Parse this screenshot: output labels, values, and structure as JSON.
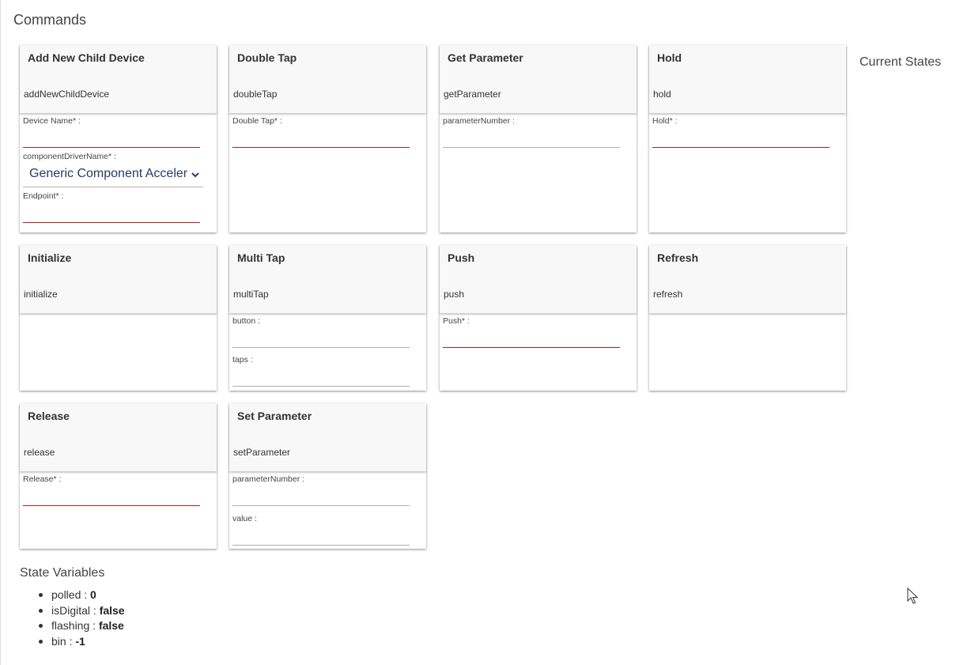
{
  "header": {
    "title": "Commands",
    "current_states": "Current States"
  },
  "commands": {
    "add_new_child_device": {
      "name": "Add New Child Device",
      "method": "addNewChildDevice",
      "fields": {
        "device_name": {
          "label": "Device Name* :",
          "value": ""
        },
        "component_driver_name": {
          "label": "componentDriverName* :",
          "selected": "Generic Component Accelerometer"
        },
        "endpoint": {
          "label": "Endpoint* :",
          "value": ""
        }
      }
    },
    "double_tap": {
      "name": "Double Tap",
      "method": "doubleTap",
      "fields": {
        "double_tap": {
          "label": "Double Tap* :",
          "value": ""
        }
      }
    },
    "get_parameter": {
      "name": "Get Parameter",
      "method": "getParameter",
      "fields": {
        "parameter_number": {
          "label": "parameterNumber :",
          "value": ""
        }
      }
    },
    "hold": {
      "name": "Hold",
      "method": "hold",
      "fields": {
        "hold": {
          "label": "Hold* :",
          "value": ""
        }
      }
    },
    "initialize": {
      "name": "Initialize",
      "method": "initialize"
    },
    "multi_tap": {
      "name": "Multi Tap",
      "method": "multiTap",
      "fields": {
        "button": {
          "label": "button :",
          "value": ""
        },
        "taps": {
          "label": "taps :",
          "value": ""
        }
      }
    },
    "push": {
      "name": "Push",
      "method": "push",
      "fields": {
        "push": {
          "label": "Push* :",
          "value": ""
        }
      }
    },
    "refresh": {
      "name": "Refresh",
      "method": "refresh"
    },
    "release": {
      "name": "Release",
      "method": "release",
      "fields": {
        "release": {
          "label": "Release* :",
          "value": ""
        }
      }
    },
    "set_parameter": {
      "name": "Set Parameter",
      "method": "setParameter",
      "fields": {
        "parameter_number": {
          "label": "parameterNumber :",
          "value": ""
        },
        "value": {
          "label": "value :",
          "value": ""
        }
      }
    }
  },
  "state_variables": {
    "title": "State Variables",
    "items": [
      {
        "key": "polled : ",
        "value": "0"
      },
      {
        "key": "isDigital : ",
        "value": "false"
      },
      {
        "key": "flashing : ",
        "value": "false"
      },
      {
        "key": "bin : ",
        "value": "-1"
      }
    ]
  },
  "colors": {
    "required_underline": "#b71c1c",
    "select_text": "#2b3a66",
    "card_header": "#f8f8f8"
  },
  "icons": {
    "dropdown": "chevron-down-icon",
    "pointer": "mouse-pointer-icon"
  }
}
